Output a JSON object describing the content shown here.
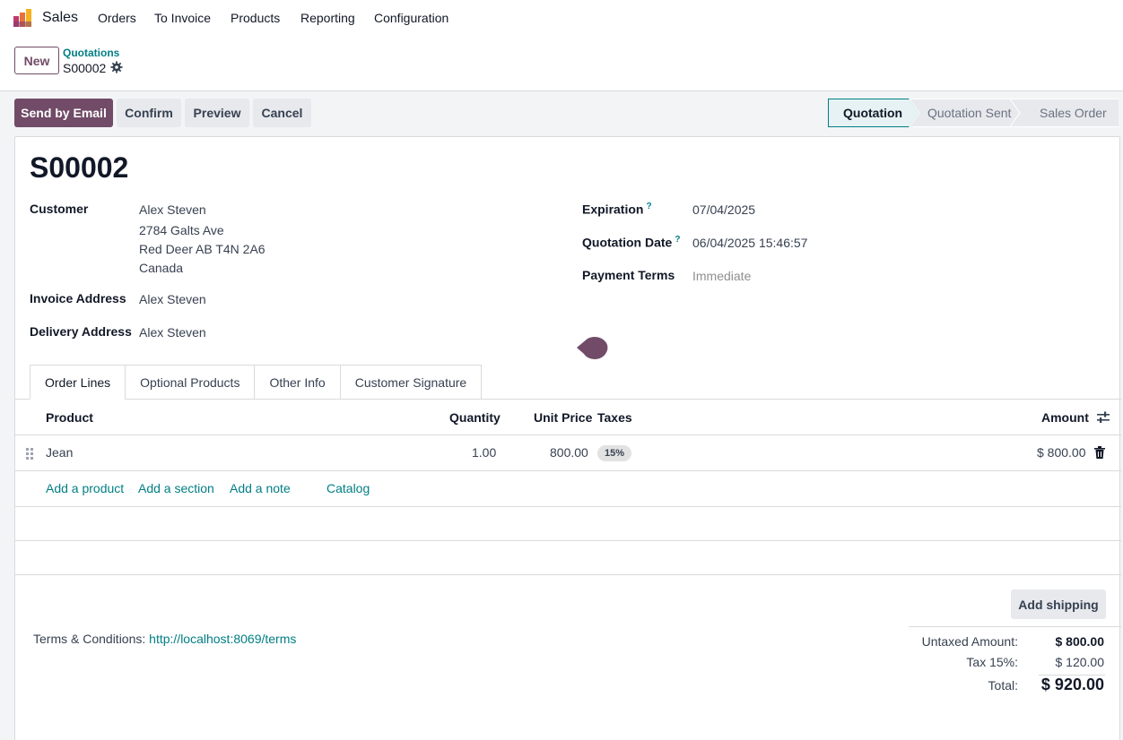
{
  "nav": {
    "app": "Sales",
    "items": [
      "Orders",
      "To Invoice",
      "Products",
      "Reporting",
      "Configuration"
    ]
  },
  "control": {
    "new_label": "New",
    "breadcrumb_parent": "Quotations",
    "breadcrumb_current": "S00002"
  },
  "actions": {
    "send_email": "Send by Email",
    "confirm": "Confirm",
    "preview": "Preview",
    "cancel": "Cancel"
  },
  "stages": [
    "Quotation",
    "Quotation Sent",
    "Sales Order"
  ],
  "order": {
    "name": "S00002",
    "customer_label": "Customer",
    "customer_name": "Alex Steven",
    "customer_address": [
      "2784 Galts Ave",
      "Red Deer AB T4N 2A6",
      "Canada"
    ],
    "invoice_label": "Invoice Address",
    "invoice_value": "Alex Steven",
    "delivery_label": "Delivery Address",
    "delivery_value": "Alex Steven",
    "expiration_label": "Expiration",
    "expiration_value": "07/04/2025",
    "quotation_date_label": "Quotation Date",
    "quotation_date_value": "06/04/2025 15:46:57",
    "payment_terms_label": "Payment Terms",
    "payment_terms_value": "Immediate",
    "help_mark": "?"
  },
  "tabs": [
    "Order Lines",
    "Optional Products",
    "Other Info",
    "Customer Signature"
  ],
  "table": {
    "columns": {
      "product": "Product",
      "quantity": "Quantity",
      "unit_price": "Unit Price",
      "taxes": "Taxes",
      "amount": "Amount"
    },
    "rows": [
      {
        "product": "Jean",
        "quantity": "1.00",
        "unit_price": "800.00",
        "tax": "15%",
        "amount": "$ 800.00"
      }
    ],
    "add_product": "Add a product",
    "add_section": "Add a section",
    "add_note": "Add a note",
    "catalog": "Catalog"
  },
  "footer": {
    "add_shipping": "Add shipping",
    "terms_label": "Terms & Conditions:",
    "terms_link": "http://localhost:8069/terms",
    "untaxed_label": "Untaxed Amount:",
    "untaxed_value": "$ 800.00",
    "tax_label": "Tax 15%:",
    "tax_value": "$ 120.00",
    "total_label": "Total:",
    "total_value": "$ 920.00"
  },
  "colors": {
    "primary": "#714b67",
    "link": "#017e84"
  }
}
